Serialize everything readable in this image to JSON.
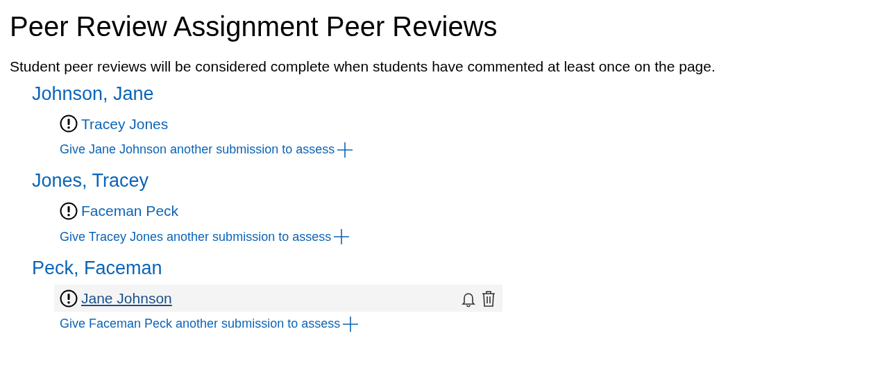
{
  "title": "Peer Review Assignment Peer Reviews",
  "description": "Student peer reviews will be considered complete when students have commented at least once on the page.",
  "students": [
    {
      "name": "Johnson, Jane",
      "reviews": [
        {
          "reviewer": "Tracey Jones",
          "hovered": false
        }
      ],
      "assign_link": "Give Jane Johnson another submission to assess"
    },
    {
      "name": "Jones, Tracey",
      "reviews": [
        {
          "reviewer": "Faceman Peck",
          "hovered": false
        }
      ],
      "assign_link": "Give Tracey Jones another submission to assess"
    },
    {
      "name": "Peck, Faceman",
      "reviews": [
        {
          "reviewer": "Jane Johnson",
          "hovered": true
        }
      ],
      "assign_link": "Give Faceman Peck another submission to assess"
    }
  ]
}
